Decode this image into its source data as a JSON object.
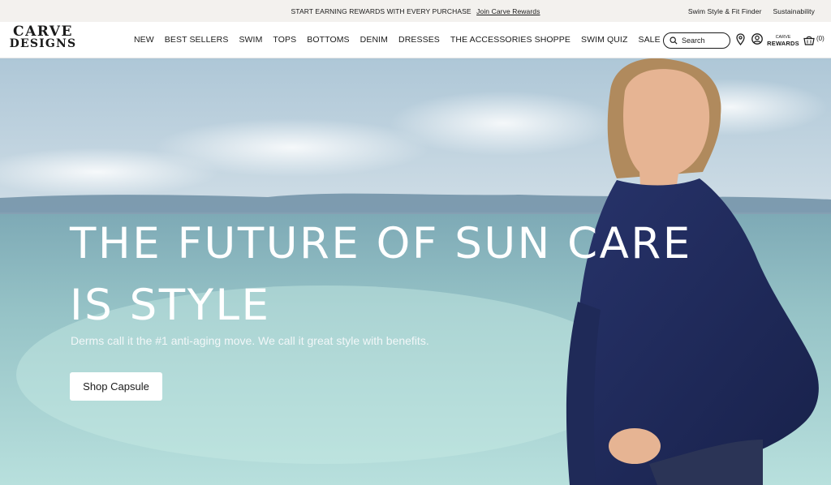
{
  "promo": {
    "text": "START EARNING REWARDS WITH EVERY PURCHASE",
    "link": "Join Carve Rewards",
    "right_links": [
      "Swim Style & Fit Finder",
      "Sustainability"
    ]
  },
  "brand": {
    "line1": "CARVE",
    "line2": "DESIGNS"
  },
  "nav": [
    "NEW",
    "BEST SELLERS",
    "SWIM",
    "TOPS",
    "BOTTOMS",
    "DENIM",
    "DRESSES",
    "THE ACCESSORIES SHOPPE",
    "SWIM QUIZ",
    "SALE"
  ],
  "search": {
    "placeholder": "Search"
  },
  "rewards": {
    "small": "CARVE",
    "big": "REWARDS"
  },
  "cart": {
    "count": "(0)"
  },
  "hero": {
    "headline_line1": "THE FUTURE OF SUN CARE",
    "headline_line2": "IS STYLE",
    "subline": "Derms call it the #1 anti-aging move. We call it great style with benefits.",
    "cta": "Shop Capsule"
  },
  "colors": {
    "promo_bg": "#f3f1ee",
    "text": "#1a1a1a",
    "jacket": "#1f2a55"
  },
  "icons": [
    "search-icon",
    "location-pin-icon",
    "account-icon",
    "cart-basket-icon"
  ]
}
